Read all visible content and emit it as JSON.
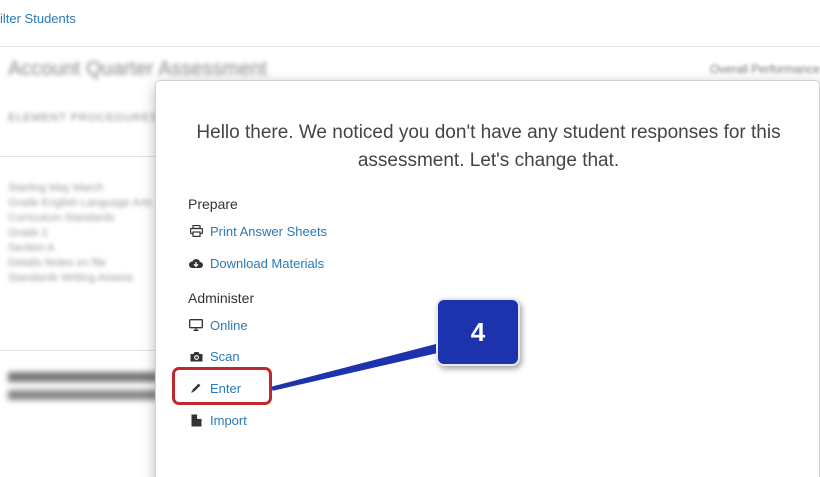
{
  "background": {
    "filter_link": "ilter Students",
    "title_blurred": "Account Quarter Assessment",
    "right_blurred": "Overall Performance",
    "subtitle_blurred": "ELEMENT PROCEDURES",
    "lines_blurred": [
      "Starting May March",
      "Grade English Language Arts",
      "Curriculum Standards",
      "Grade 2",
      "Section A",
      "Details Notes on file",
      "Standards Writing Assess"
    ]
  },
  "modal": {
    "message": "Hello there. We noticed you don't have any student responses for this assessment. Let's change that.",
    "prepare": {
      "title": "Prepare",
      "items": [
        {
          "label": "Print Answer Sheets",
          "icon": "printer-icon"
        },
        {
          "label": "Download Materials",
          "icon": "cloud-download-icon"
        }
      ]
    },
    "administer": {
      "title": "Administer",
      "items": [
        {
          "label": "Online",
          "icon": "monitor-icon"
        },
        {
          "label": "Scan",
          "icon": "camera-icon"
        },
        {
          "label": "Enter",
          "icon": "pencil-icon"
        },
        {
          "label": "Import",
          "icon": "file-icon"
        }
      ]
    }
  },
  "callout": {
    "step": "4",
    "badge_color": "#1c33ad",
    "highlight_color": "#c0282f"
  }
}
